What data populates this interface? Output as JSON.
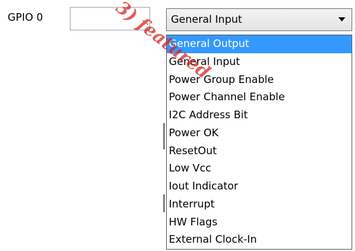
{
  "gpio": {
    "label": "GPIO 0",
    "value": ""
  },
  "function_select": {
    "selected": "General Input",
    "options": [
      "General Output",
      "General Input",
      "Power Group Enable",
      "Power Channel Enable",
      "I2C Address Bit",
      "Power OK",
      "ResetOut",
      "Low Vcc",
      "Iout Indicator",
      "Interrupt",
      "HW Flags",
      "External Clock-In"
    ],
    "highlighted": "General Output",
    "chevron_icon": "chevron-down-icon"
  },
  "watermark": "3) featured",
  "colors": {
    "highlight": "#3399ff",
    "watermark": "#d22828"
  }
}
